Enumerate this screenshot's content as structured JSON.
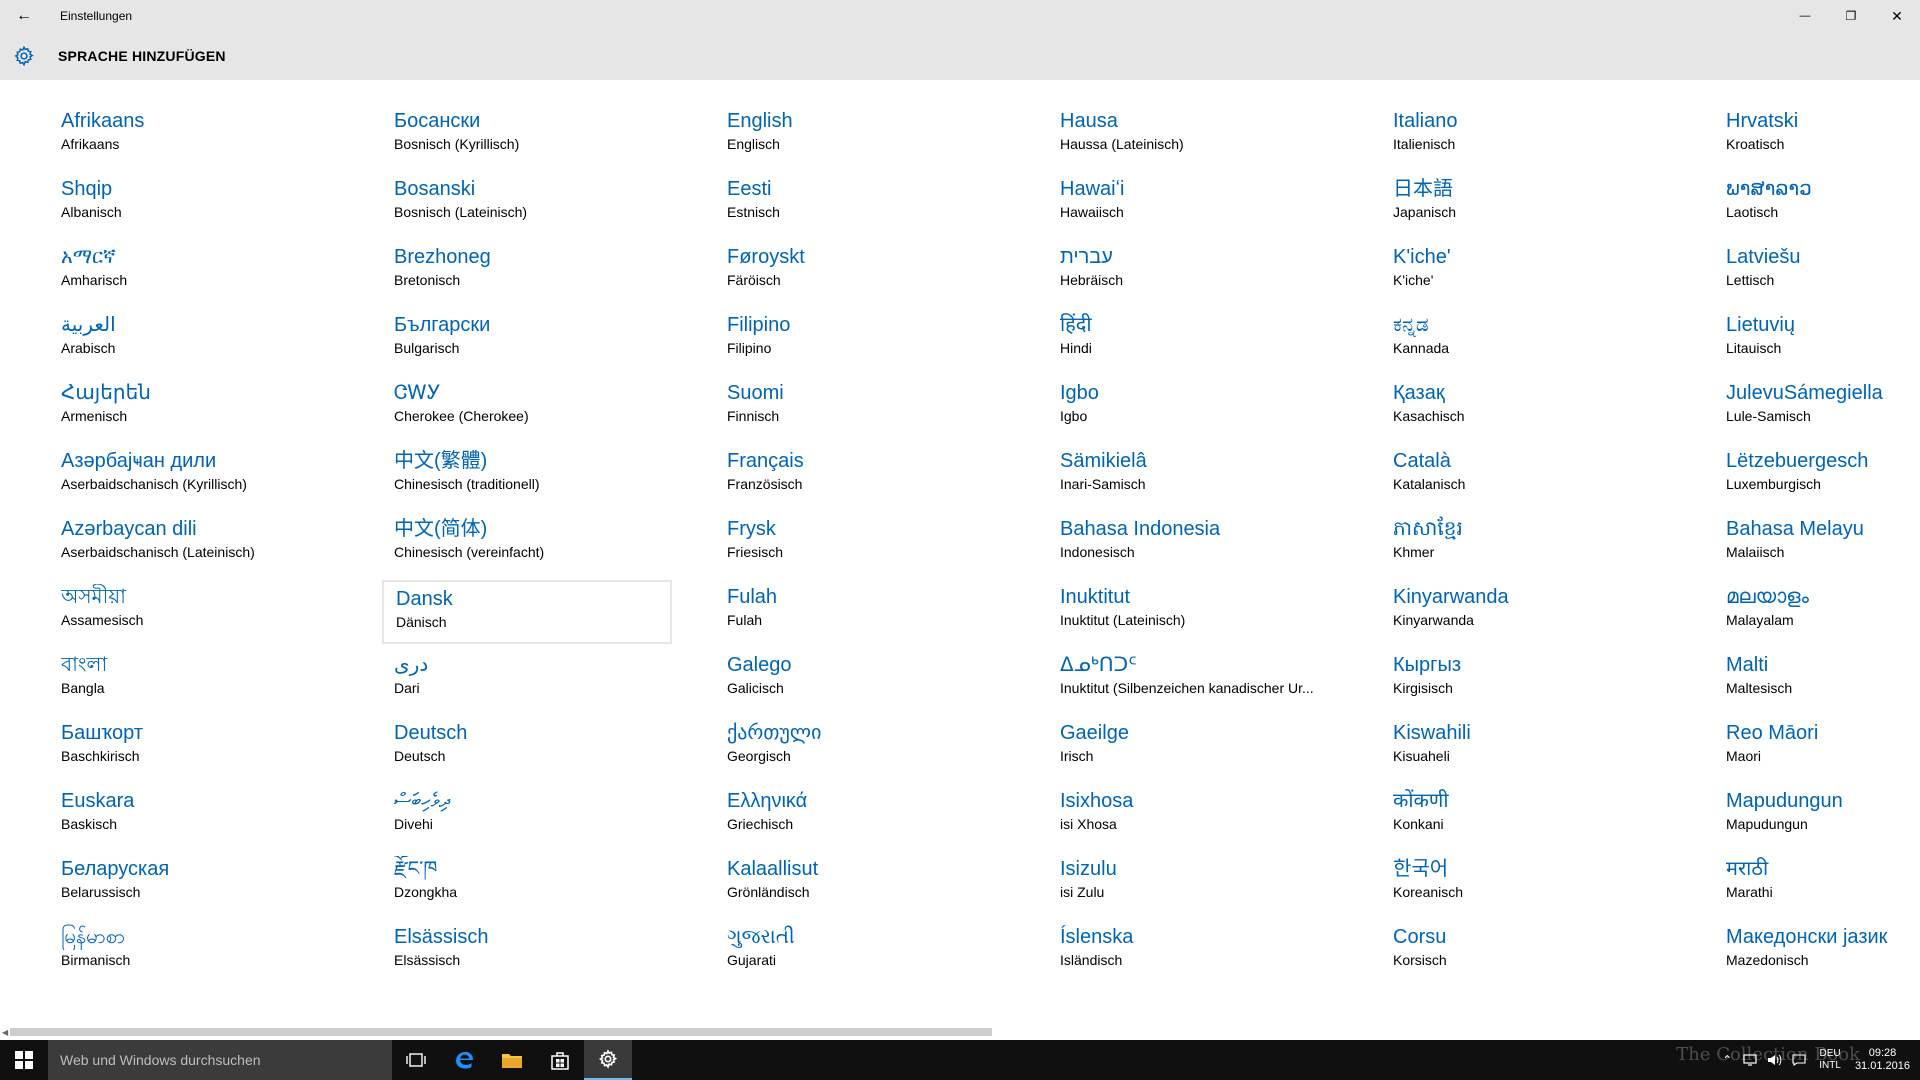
{
  "window": {
    "title": "Einstellungen",
    "back_glyph": "←",
    "minimize_glyph": "—",
    "restore_glyph": "❐",
    "close_glyph": "✕"
  },
  "header": {
    "title": "SPRACHE HINZUFÜGEN"
  },
  "languages": [
    {
      "native": "Afrikaans",
      "german": "Afrikaans"
    },
    {
      "native": "Shqip",
      "german": "Albanisch"
    },
    {
      "native": "አማርኛ",
      "german": "Amharisch"
    },
    {
      "native": "العربية",
      "german": "Arabisch"
    },
    {
      "native": "Հայերեն",
      "german": "Armenisch"
    },
    {
      "native": "Азәрбајҹан дили",
      "german": "Aserbaidschanisch (Kyrillisch)"
    },
    {
      "native": "Azərbaycan dili",
      "german": "Aserbaidschanisch (Lateinisch)"
    },
    {
      "native": "অসমীয়া",
      "german": "Assamesisch"
    },
    {
      "native": "বাংলা",
      "german": "Bangla"
    },
    {
      "native": "Башҡорт",
      "german": "Baschkirisch"
    },
    {
      "native": "Euskara",
      "german": "Baskisch"
    },
    {
      "native": "Беларуская",
      "german": "Belarussisch"
    },
    {
      "native": "မြန်မာစာ",
      "german": "Birmanisch"
    },
    {
      "native": "Босански",
      "german": "Bosnisch (Kyrillisch)"
    },
    {
      "native": "Bosanski",
      "german": "Bosnisch (Lateinisch)"
    },
    {
      "native": "Brezhoneg",
      "german": "Bretonisch"
    },
    {
      "native": "Български",
      "german": "Bulgarisch"
    },
    {
      "native": "ᏣᎳᎩ",
      "german": "Cherokee (Cherokee)"
    },
    {
      "native": "中文(繁體)",
      "german": "Chinesisch (traditionell)"
    },
    {
      "native": "中文(简体)",
      "german": "Chinesisch (vereinfacht)"
    },
    {
      "native": "Dansk",
      "german": "Dänisch"
    },
    {
      "native": "دری",
      "german": "Dari"
    },
    {
      "native": "Deutsch",
      "german": "Deutsch"
    },
    {
      "native": "ދިވެހިބަސް",
      "german": "Divehi"
    },
    {
      "native": "རྫོང་ཁ",
      "german": "Dzongkha"
    },
    {
      "native": "Elsässisch",
      "german": "Elsässisch"
    },
    {
      "native": "English",
      "german": "Englisch"
    },
    {
      "native": "Eesti",
      "german": "Estnisch"
    },
    {
      "native": "Føroyskt",
      "german": "Färöisch"
    },
    {
      "native": "Filipino",
      "german": "Filipino"
    },
    {
      "native": "Suomi",
      "german": "Finnisch"
    },
    {
      "native": "Français",
      "german": "Französisch"
    },
    {
      "native": "Frysk",
      "german": "Friesisch"
    },
    {
      "native": "Fulah",
      "german": "Fulah"
    },
    {
      "native": "Galego",
      "german": "Galicisch"
    },
    {
      "native": "ქართული",
      "german": "Georgisch"
    },
    {
      "native": "Ελληνικά",
      "german": "Griechisch"
    },
    {
      "native": "Kalaallisut",
      "german": "Grönländisch"
    },
    {
      "native": "ગુજરાતી",
      "german": "Gujarati"
    },
    {
      "native": "Hausa",
      "german": "Haussa (Lateinisch)"
    },
    {
      "native": "Hawaiʻi",
      "german": "Hawaiisch"
    },
    {
      "native": "עברית",
      "german": "Hebräisch"
    },
    {
      "native": "हिंदी",
      "german": "Hindi"
    },
    {
      "native": "Igbo",
      "german": "Igbo"
    },
    {
      "native": "Sämikielâ",
      "german": "Inari-Samisch"
    },
    {
      "native": "Bahasa Indonesia",
      "german": "Indonesisch"
    },
    {
      "native": "Inuktitut",
      "german": "Inuktitut (Lateinisch)"
    },
    {
      "native": "ᐃᓄᒃᑎᑐᑦ",
      "german": "Inuktitut (Silbenzeichen kanadischer Ur..."
    },
    {
      "native": "Gaeilge",
      "german": "Irisch"
    },
    {
      "native": "Isixhosa",
      "german": "isi Xhosa"
    },
    {
      "native": "Isizulu",
      "german": "isi Zulu"
    },
    {
      "native": "Íslenska",
      "german": "Isländisch"
    },
    {
      "native": "Italiano",
      "german": "Italienisch"
    },
    {
      "native": "日本語",
      "german": "Japanisch"
    },
    {
      "native": "K'iche'",
      "german": "K'iche'"
    },
    {
      "native": "ಕನ್ನಡ",
      "german": "Kannada"
    },
    {
      "native": "Қазақ",
      "german": "Kasachisch"
    },
    {
      "native": "Català",
      "german": "Katalanisch"
    },
    {
      "native": "ភាសាខ្មែរ",
      "german": "Khmer"
    },
    {
      "native": "Kinyarwanda",
      "german": "Kinyarwanda"
    },
    {
      "native": "Кыргыз",
      "german": "Kirgisisch"
    },
    {
      "native": "Kiswahili",
      "german": "Kisuaheli"
    },
    {
      "native": "कोंकणी",
      "german": "Konkani"
    },
    {
      "native": "한국어",
      "german": "Koreanisch"
    },
    {
      "native": "Corsu",
      "german": "Korsisch"
    },
    {
      "native": "Hrvatski",
      "german": "Kroatisch"
    },
    {
      "native": "ພາສາລາວ",
      "german": "Laotisch"
    },
    {
      "native": "Latviešu",
      "german": "Lettisch"
    },
    {
      "native": "Lietuvių",
      "german": "Litauisch"
    },
    {
      "native": "JulevuSámegiella",
      "german": "Lule-Samisch"
    },
    {
      "native": "Lëtzebuergesch",
      "german": "Luxemburgisch"
    },
    {
      "native": "Bahasa Melayu",
      "german": "Malaiisch"
    },
    {
      "native": "മലയാളം",
      "german": "Malayalam"
    },
    {
      "native": "Malti",
      "german": "Maltesisch"
    },
    {
      "native": "Reo Māori",
      "german": "Maori"
    },
    {
      "native": "Mapudungun",
      "german": "Mapudungun"
    },
    {
      "native": "मराठी",
      "german": "Marathi"
    },
    {
      "native": "Македонски јазик",
      "german": "Mazedonisch"
    }
  ],
  "selected_language": "Dansk",
  "taskbar": {
    "search_placeholder": "Web und Windows durchsuchen",
    "input_lang_top": "DEU",
    "input_lang_bottom": "INTL",
    "time": "09:28",
    "date": "31.01.2016",
    "watermark": "The Collection Book"
  },
  "colors": {
    "accent": "#0063b1",
    "chrome": "#e6e6e6",
    "taskbar": "#101010"
  }
}
